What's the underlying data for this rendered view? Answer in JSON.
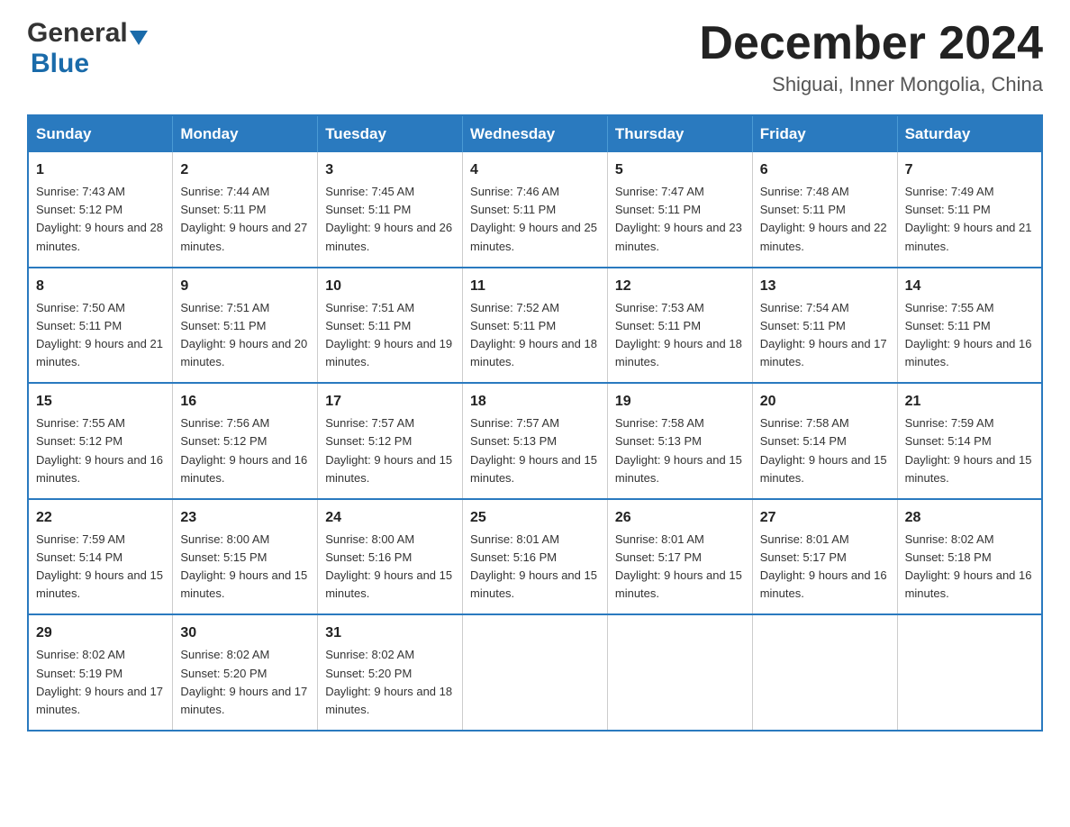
{
  "logo": {
    "general": "General",
    "blue": "Blue"
  },
  "title": "December 2024",
  "subtitle": "Shiguai, Inner Mongolia, China",
  "headers": [
    "Sunday",
    "Monday",
    "Tuesday",
    "Wednesday",
    "Thursday",
    "Friday",
    "Saturday"
  ],
  "weeks": [
    [
      {
        "day": "1",
        "sunrise": "7:43 AM",
        "sunset": "5:12 PM",
        "daylight": "9 hours and 28 minutes."
      },
      {
        "day": "2",
        "sunrise": "7:44 AM",
        "sunset": "5:11 PM",
        "daylight": "9 hours and 27 minutes."
      },
      {
        "day": "3",
        "sunrise": "7:45 AM",
        "sunset": "5:11 PM",
        "daylight": "9 hours and 26 minutes."
      },
      {
        "day": "4",
        "sunrise": "7:46 AM",
        "sunset": "5:11 PM",
        "daylight": "9 hours and 25 minutes."
      },
      {
        "day": "5",
        "sunrise": "7:47 AM",
        "sunset": "5:11 PM",
        "daylight": "9 hours and 23 minutes."
      },
      {
        "day": "6",
        "sunrise": "7:48 AM",
        "sunset": "5:11 PM",
        "daylight": "9 hours and 22 minutes."
      },
      {
        "day": "7",
        "sunrise": "7:49 AM",
        "sunset": "5:11 PM",
        "daylight": "9 hours and 21 minutes."
      }
    ],
    [
      {
        "day": "8",
        "sunrise": "7:50 AM",
        "sunset": "5:11 PM",
        "daylight": "9 hours and 21 minutes."
      },
      {
        "day": "9",
        "sunrise": "7:51 AM",
        "sunset": "5:11 PM",
        "daylight": "9 hours and 20 minutes."
      },
      {
        "day": "10",
        "sunrise": "7:51 AM",
        "sunset": "5:11 PM",
        "daylight": "9 hours and 19 minutes."
      },
      {
        "day": "11",
        "sunrise": "7:52 AM",
        "sunset": "5:11 PM",
        "daylight": "9 hours and 18 minutes."
      },
      {
        "day": "12",
        "sunrise": "7:53 AM",
        "sunset": "5:11 PM",
        "daylight": "9 hours and 18 minutes."
      },
      {
        "day": "13",
        "sunrise": "7:54 AM",
        "sunset": "5:11 PM",
        "daylight": "9 hours and 17 minutes."
      },
      {
        "day": "14",
        "sunrise": "7:55 AM",
        "sunset": "5:11 PM",
        "daylight": "9 hours and 16 minutes."
      }
    ],
    [
      {
        "day": "15",
        "sunrise": "7:55 AM",
        "sunset": "5:12 PM",
        "daylight": "9 hours and 16 minutes."
      },
      {
        "day": "16",
        "sunrise": "7:56 AM",
        "sunset": "5:12 PM",
        "daylight": "9 hours and 16 minutes."
      },
      {
        "day": "17",
        "sunrise": "7:57 AM",
        "sunset": "5:12 PM",
        "daylight": "9 hours and 15 minutes."
      },
      {
        "day": "18",
        "sunrise": "7:57 AM",
        "sunset": "5:13 PM",
        "daylight": "9 hours and 15 minutes."
      },
      {
        "day": "19",
        "sunrise": "7:58 AM",
        "sunset": "5:13 PM",
        "daylight": "9 hours and 15 minutes."
      },
      {
        "day": "20",
        "sunrise": "7:58 AM",
        "sunset": "5:14 PM",
        "daylight": "9 hours and 15 minutes."
      },
      {
        "day": "21",
        "sunrise": "7:59 AM",
        "sunset": "5:14 PM",
        "daylight": "9 hours and 15 minutes."
      }
    ],
    [
      {
        "day": "22",
        "sunrise": "7:59 AM",
        "sunset": "5:14 PM",
        "daylight": "9 hours and 15 minutes."
      },
      {
        "day": "23",
        "sunrise": "8:00 AM",
        "sunset": "5:15 PM",
        "daylight": "9 hours and 15 minutes."
      },
      {
        "day": "24",
        "sunrise": "8:00 AM",
        "sunset": "5:16 PM",
        "daylight": "9 hours and 15 minutes."
      },
      {
        "day": "25",
        "sunrise": "8:01 AM",
        "sunset": "5:16 PM",
        "daylight": "9 hours and 15 minutes."
      },
      {
        "day": "26",
        "sunrise": "8:01 AM",
        "sunset": "5:17 PM",
        "daylight": "9 hours and 15 minutes."
      },
      {
        "day": "27",
        "sunrise": "8:01 AM",
        "sunset": "5:17 PM",
        "daylight": "9 hours and 16 minutes."
      },
      {
        "day": "28",
        "sunrise": "8:02 AM",
        "sunset": "5:18 PM",
        "daylight": "9 hours and 16 minutes."
      }
    ],
    [
      {
        "day": "29",
        "sunrise": "8:02 AM",
        "sunset": "5:19 PM",
        "daylight": "9 hours and 17 minutes."
      },
      {
        "day": "30",
        "sunrise": "8:02 AM",
        "sunset": "5:20 PM",
        "daylight": "9 hours and 17 minutes."
      },
      {
        "day": "31",
        "sunrise": "8:02 AM",
        "sunset": "5:20 PM",
        "daylight": "9 hours and 18 minutes."
      },
      null,
      null,
      null,
      null
    ]
  ]
}
